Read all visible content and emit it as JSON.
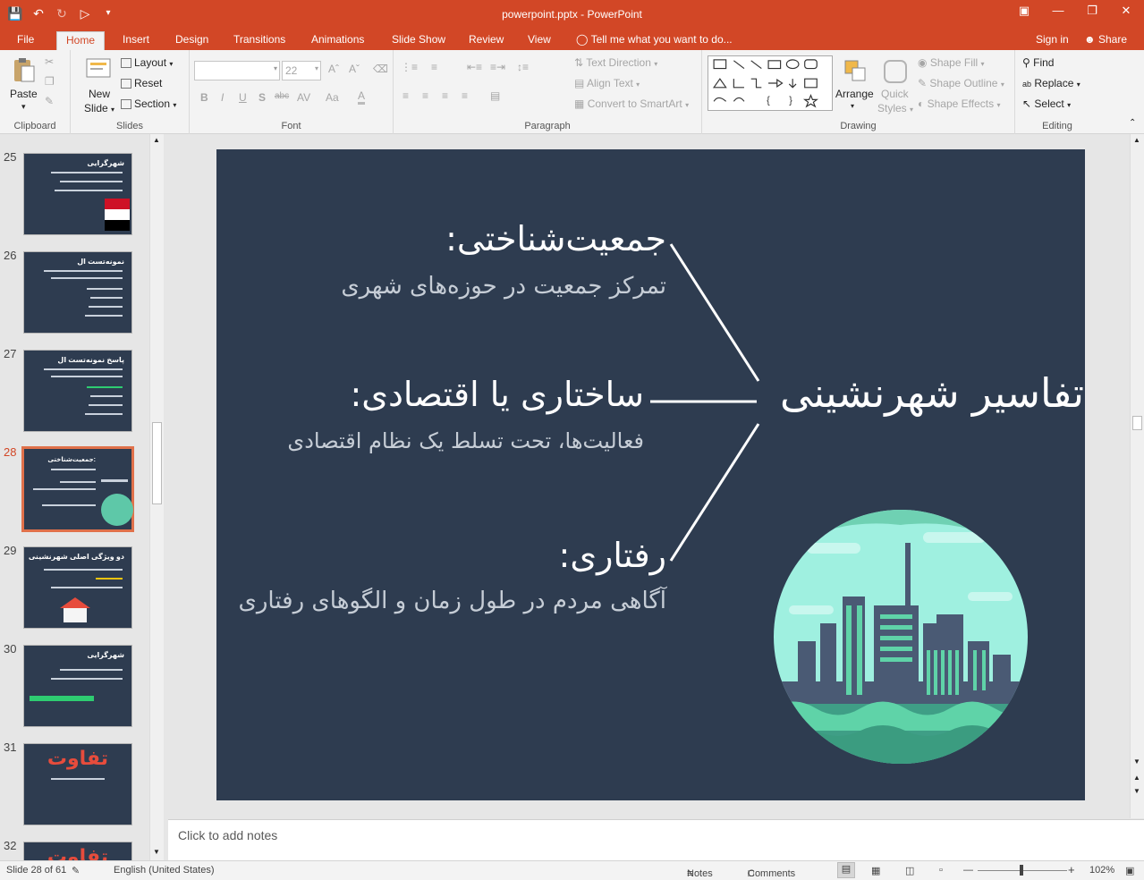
{
  "window": {
    "title": "powerpoint.pptx - PowerPoint",
    "accent": "#d24726"
  },
  "tabs": [
    "File",
    "Home",
    "Insert",
    "Design",
    "Transitions",
    "Animations",
    "Slide Show",
    "Review",
    "View"
  ],
  "active_tab": "Home",
  "tell_me": "Tell me what you want to do...",
  "sign_in": "Sign in",
  "share": "Share",
  "ribbon": {
    "clipboard": {
      "label": "Clipboard",
      "paste": "Paste"
    },
    "slides": {
      "label": "Slides",
      "new_slide_1": "New",
      "new_slide_2": "Slide",
      "layout": "Layout",
      "reset": "Reset",
      "section": "Section"
    },
    "font": {
      "label": "Font",
      "size": "22"
    },
    "paragraph": {
      "label": "Paragraph",
      "text_direction": "Text Direction",
      "align_text": "Align Text",
      "convert": "Convert to SmartArt"
    },
    "drawing": {
      "label": "Drawing",
      "arrange": "Arrange",
      "quick_styles_1": "Quick",
      "quick_styles_2": "Styles",
      "shape_fill": "Shape Fill",
      "shape_outline": "Shape Outline",
      "shape_effects": "Shape Effects"
    },
    "editing": {
      "label": "Editing",
      "find": "Find",
      "replace": "Replace",
      "select": "Select"
    }
  },
  "thumbnails": [
    {
      "num": "25",
      "title": "شهرگرایی"
    },
    {
      "num": "26",
      "title": "نمونه‌تست ال"
    },
    {
      "num": "27",
      "title": "پاسخ نمونه‌تست ال"
    },
    {
      "num": "28",
      "title": "جمعیت‌شناختی:"
    },
    {
      "num": "29",
      "title": "دو ویژگی اصلی شهرنشینی"
    },
    {
      "num": "30",
      "title": "شهرگرایی"
    },
    {
      "num": "31",
      "title": "تفاوت"
    },
    {
      "num": "32",
      "title": "تفاوت"
    }
  ],
  "selected_slide": "28",
  "slide": {
    "center_title": "تفاسیر شهرنشینی",
    "h1": "جمعیت‌شناختی:",
    "s1": "تمرکز جمعیت در حوزه‌های شهری",
    "h2": "ساختاری یا اقتصادی:",
    "s2": "فعالیت‌ها، تحت تسلط یک نظام اقتصادی",
    "h3": "رفتاری:",
    "s3": "آگاهی مردم در طول زمان و الگوهای رفتاری",
    "bg": "#2e3c50"
  },
  "notes_placeholder": "Click to add notes",
  "status": {
    "slide_info": "Slide 28 of 61",
    "language": "English (United States)",
    "notes": "Notes",
    "comments": "Comments",
    "zoom": "102%"
  }
}
